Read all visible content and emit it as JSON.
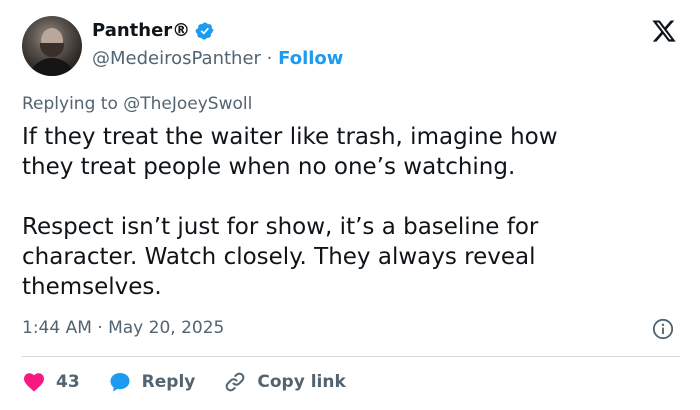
{
  "author": {
    "name": "Panther®",
    "handle": "@MedeirosPanther",
    "separator": "·",
    "follow_label": "Follow"
  },
  "reply_to": "Replying to @TheJoeySwoll",
  "tweet": {
    "paragraph1": "If they treat the waiter like trash, imagine how\nthey treat people when no one’s watching.",
    "paragraph2": "Respect isn’t just for show, it’s a baseline for\ncharacter. Watch closely. They always reveal\nthemselves."
  },
  "timestamp": "1:44 AM · May 20, 2025",
  "actions": {
    "like_count": "43",
    "reply_label": "Reply",
    "copy_link_label": "Copy link"
  },
  "colors": {
    "accent": "#1d9bf0",
    "like": "#f91880",
    "muted": "#536471",
    "text": "#0f1419"
  },
  "icons": [
    "verified-badge-icon",
    "x-logo-icon",
    "info-icon",
    "heart-icon",
    "reply-bubble-icon",
    "link-icon"
  ]
}
